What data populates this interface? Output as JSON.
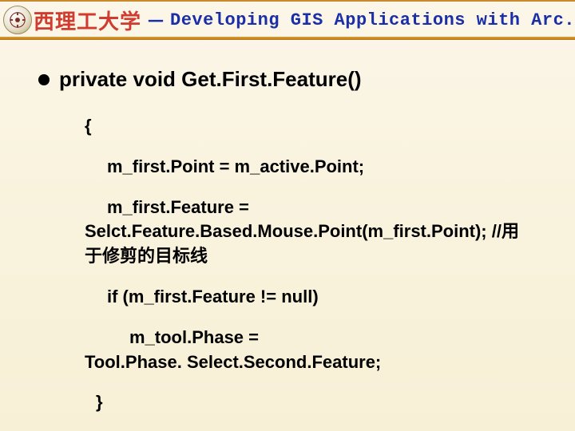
{
  "header": {
    "cn_partial": "西理工大学",
    "dash": "－",
    "en": "Developing GIS Applications with Arc.Objects using C#. NE"
  },
  "slide": {
    "bullet": "private void Get.First.Feature()",
    "code": {
      "l1": "{",
      "l2": "m_first.Point = m_active.Point;",
      "l3a": "m_first.Feature =",
      "l3b": "Selct.Feature.Based.Mouse.Point(m_first.Point); //用",
      "l3c": "于修剪的目标线",
      "l4": "if (m_first.Feature != null)",
      "l5": "m_tool.Phase =",
      "l6": "Tool.Phase. Select.Second.Feature;",
      "l7": "}"
    }
  }
}
